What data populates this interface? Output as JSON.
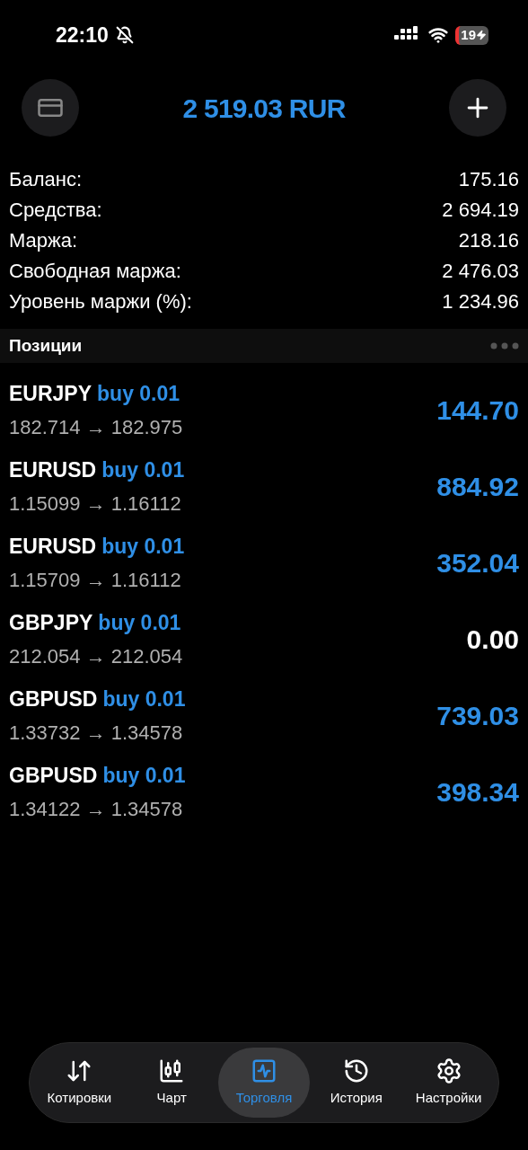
{
  "status_bar": {
    "time": "22:10",
    "battery": "19"
  },
  "header": {
    "title": "2 519.03 RUR"
  },
  "summary": [
    {
      "label": "Баланс:",
      "value": "175.16"
    },
    {
      "label": "Средства:",
      "value": "2 694.19"
    },
    {
      "label": "Маржа:",
      "value": "218.16"
    },
    {
      "label": "Свободная маржа:",
      "value": "2 476.03"
    },
    {
      "label": "Уровень маржи (%):",
      "value": "1 234.96"
    }
  ],
  "positions": {
    "title": "Позиции",
    "items": [
      {
        "symbol": "EURJPY",
        "side": "buy 0.01",
        "prices": "182.714 → 182.975",
        "profit": "144.70",
        "color": "#2f8fe6"
      },
      {
        "symbol": "EURUSD",
        "side": "buy 0.01",
        "prices": "1.15099 → 1.16112",
        "profit": "884.92",
        "color": "#2f8fe6"
      },
      {
        "symbol": "EURUSD",
        "side": "buy 0.01",
        "prices": "1.15709 → 1.16112",
        "profit": "352.04",
        "color": "#2f8fe6"
      },
      {
        "symbol": "GBPJPY",
        "side": "buy 0.01",
        "prices": "212.054 → 212.054",
        "profit": "0.00",
        "color": "#ffffff"
      },
      {
        "symbol": "GBPUSD",
        "side": "buy 0.01",
        "prices": "1.33732 → 1.34578",
        "profit": "739.03",
        "color": "#2f8fe6"
      },
      {
        "symbol": "GBPUSD",
        "side": "buy 0.01",
        "prices": "1.34122 → 1.34578",
        "profit": "398.34",
        "color": "#2f8fe6"
      }
    ]
  },
  "tab_bar": [
    {
      "kind": "quotes",
      "label": "Котировки",
      "selected": false
    },
    {
      "kind": "chart",
      "label": "Чарт",
      "selected": false
    },
    {
      "kind": "trade",
      "label": "Торговля",
      "selected": true
    },
    {
      "kind": "history",
      "label": "История",
      "selected": false
    },
    {
      "kind": "settings",
      "label": "Настройки",
      "selected": false
    }
  ]
}
